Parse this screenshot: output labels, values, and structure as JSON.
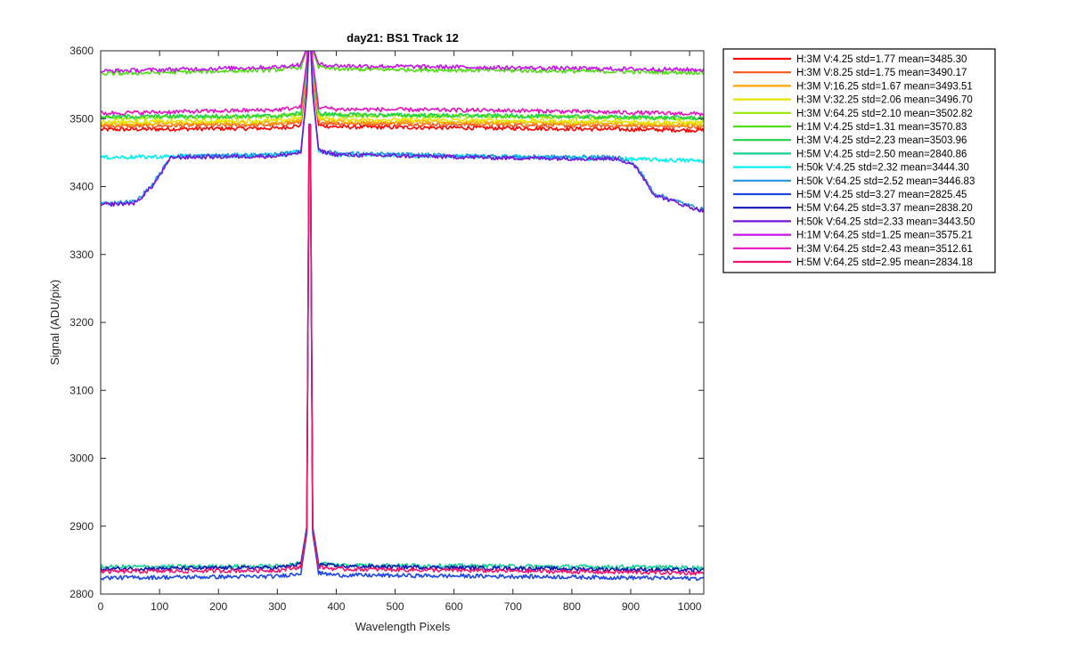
{
  "chart_data": {
    "type": "line",
    "title": "day21: BS1  Track 12",
    "xlabel": "Wavelength Pixels",
    "ylabel": "Signal (ADU/pix)",
    "xlim": [
      0,
      1024
    ],
    "ylim": [
      2800,
      3600
    ],
    "x_ticks": [
      0,
      100,
      200,
      300,
      400,
      500,
      600,
      700,
      800,
      900,
      1000
    ],
    "y_ticks": [
      2800,
      2900,
      3000,
      3100,
      3200,
      3300,
      3400,
      3500,
      3600
    ],
    "grid": false,
    "legend_position": "outside-right",
    "peak_pixel": 355,
    "series": [
      {
        "name": "H:3M V:4.25   std=1.77 mean=3485.30",
        "color": "#ff0000",
        "points": [
          [
            0,
            3484
          ],
          [
            300,
            3486
          ],
          [
            340,
            3490
          ],
          [
            350,
            3560
          ],
          [
            355,
            3640
          ],
          [
            360,
            3560
          ],
          [
            370,
            3490
          ],
          [
            400,
            3488
          ],
          [
            700,
            3486
          ],
          [
            1024,
            3483
          ]
        ]
      },
      {
        "name": "H:3M V:8.25   std=1.75 mean=3490.17",
        "color": "#ff5a1e",
        "points": [
          [
            0,
            3489
          ],
          [
            300,
            3491
          ],
          [
            340,
            3495
          ],
          [
            350,
            3565
          ],
          [
            355,
            3640
          ],
          [
            360,
            3565
          ],
          [
            370,
            3495
          ],
          [
            400,
            3493
          ],
          [
            700,
            3491
          ],
          [
            1024,
            3488
          ]
        ]
      },
      {
        "name": "H:3M V:16.25  std=1.67 mean=3493.51",
        "color": "#ffa500",
        "points": [
          [
            0,
            3492
          ],
          [
            300,
            3494
          ],
          [
            340,
            3498
          ],
          [
            350,
            3568
          ],
          [
            355,
            3640
          ],
          [
            360,
            3568
          ],
          [
            370,
            3498
          ],
          [
            400,
            3496
          ],
          [
            700,
            3494
          ],
          [
            1024,
            3491
          ]
        ]
      },
      {
        "name": "H:3M V:32.25  std=2.06 mean=3496.70",
        "color": "#e5e500",
        "points": [
          [
            0,
            3495
          ],
          [
            300,
            3497
          ],
          [
            340,
            3501
          ],
          [
            350,
            3570
          ],
          [
            355,
            3640
          ],
          [
            360,
            3570
          ],
          [
            370,
            3501
          ],
          [
            400,
            3499
          ],
          [
            700,
            3497
          ],
          [
            1024,
            3494
          ]
        ]
      },
      {
        "name": "H:3M V:64.25  std=2.10 mean=3502.82",
        "color": "#96e600",
        "points": [
          [
            0,
            3501
          ],
          [
            300,
            3503
          ],
          [
            340,
            3507
          ],
          [
            350,
            3575
          ],
          [
            355,
            3640
          ],
          [
            360,
            3575
          ],
          [
            370,
            3507
          ],
          [
            400,
            3505
          ],
          [
            700,
            3503
          ],
          [
            1024,
            3500
          ]
        ]
      },
      {
        "name": "H:1M V:4.25   std=1.31 mean=3570.83",
        "color": "#50dc14",
        "points": [
          [
            0,
            3566
          ],
          [
            300,
            3572
          ],
          [
            340,
            3576
          ],
          [
            350,
            3600
          ],
          [
            355,
            3640
          ],
          [
            360,
            3600
          ],
          [
            370,
            3576
          ],
          [
            400,
            3573
          ],
          [
            700,
            3571
          ],
          [
            1024,
            3568
          ]
        ]
      },
      {
        "name": "H:3M V:4.25   std=2.23 mean=3503.96",
        "color": "#1ed24b",
        "points": [
          [
            0,
            3503
          ],
          [
            300,
            3504
          ],
          [
            340,
            3508
          ],
          [
            350,
            3576
          ],
          [
            355,
            3640
          ],
          [
            360,
            3576
          ],
          [
            370,
            3508
          ],
          [
            400,
            3506
          ],
          [
            700,
            3504
          ],
          [
            1024,
            3501
          ]
        ]
      },
      {
        "name": "H:5M V:4.25   std=2.50 mean=2840.86",
        "color": "#14d296",
        "points": [
          [
            0,
            2840
          ],
          [
            300,
            2841
          ],
          [
            340,
            2846
          ],
          [
            350,
            2900
          ],
          [
            355,
            3640
          ],
          [
            360,
            2900
          ],
          [
            370,
            2846
          ],
          [
            400,
            2843
          ],
          [
            700,
            2841
          ],
          [
            1024,
            2839
          ]
        ]
      },
      {
        "name": "H:50k V:4.25  std=2.32 mean=3444.30",
        "color": "#00f0f0",
        "points": [
          [
            0,
            3443
          ],
          [
            300,
            3446
          ],
          [
            340,
            3452
          ],
          [
            350,
            3540
          ],
          [
            355,
            3640
          ],
          [
            360,
            3540
          ],
          [
            370,
            3452
          ],
          [
            400,
            3447
          ],
          [
            700,
            3444
          ],
          [
            1024,
            3438
          ]
        ]
      },
      {
        "name": "H:50k V:64.25 std=2.52 mean=3446.83",
        "color": "#1e96e6",
        "points": [
          [
            0,
            3375
          ],
          [
            60,
            3378
          ],
          [
            90,
            3405
          ],
          [
            120,
            3445
          ],
          [
            300,
            3447
          ],
          [
            340,
            3452
          ],
          [
            350,
            3540
          ],
          [
            355,
            3640
          ],
          [
            360,
            3540
          ],
          [
            370,
            3455
          ],
          [
            400,
            3449
          ],
          [
            700,
            3444
          ],
          [
            880,
            3443
          ],
          [
            910,
            3430
          ],
          [
            940,
            3390
          ],
          [
            1000,
            3372
          ],
          [
            1024,
            3366
          ]
        ]
      },
      {
        "name": "H:5M V:4.25   std=3.27 mean=2825.45",
        "color": "#1e46e6",
        "points": [
          [
            0,
            2824
          ],
          [
            300,
            2826
          ],
          [
            340,
            2831
          ],
          [
            350,
            2890
          ],
          [
            355,
            3640
          ],
          [
            360,
            2890
          ],
          [
            370,
            2831
          ],
          [
            400,
            2828
          ],
          [
            700,
            2826
          ],
          [
            1024,
            2823
          ]
        ]
      },
      {
        "name": "H:5M V:64.25  std=3.37 mean=2838.20",
        "color": "#1414b4",
        "points": [
          [
            0,
            2837
          ],
          [
            300,
            2839
          ],
          [
            340,
            2844
          ],
          [
            350,
            2898
          ],
          [
            355,
            3640
          ],
          [
            360,
            2898
          ],
          [
            370,
            2844
          ],
          [
            400,
            2841
          ],
          [
            700,
            2838
          ],
          [
            1024,
            2835
          ]
        ]
      },
      {
        "name": "H:50k V:64.25 std=2.33 mean=3443.50",
        "color": "#7814dc",
        "points": [
          [
            0,
            3373
          ],
          [
            60,
            3376
          ],
          [
            90,
            3403
          ],
          [
            120,
            3443
          ],
          [
            300,
            3445
          ],
          [
            340,
            3450
          ],
          [
            350,
            3538
          ],
          [
            355,
            3640
          ],
          [
            360,
            3538
          ],
          [
            370,
            3453
          ],
          [
            400,
            3447
          ],
          [
            700,
            3442
          ],
          [
            880,
            3441
          ],
          [
            910,
            3428
          ],
          [
            940,
            3388
          ],
          [
            1000,
            3370
          ],
          [
            1024,
            3364
          ]
        ]
      },
      {
        "name": "H:1M V:64.25  std=1.25 mean=3575.21",
        "color": "#c814f0",
        "points": [
          [
            0,
            3570
          ],
          [
            300,
            3576
          ],
          [
            340,
            3580
          ],
          [
            350,
            3605
          ],
          [
            355,
            3640
          ],
          [
            360,
            3605
          ],
          [
            370,
            3580
          ],
          [
            400,
            3578
          ],
          [
            700,
            3575
          ],
          [
            1024,
            3572
          ]
        ]
      },
      {
        "name": "H:3M V:64.25  std=2.43 mean=3512.61",
        "color": "#e614be",
        "points": [
          [
            0,
            3508
          ],
          [
            300,
            3513
          ],
          [
            340,
            3517
          ],
          [
            350,
            3585
          ],
          [
            355,
            3640
          ],
          [
            360,
            3585
          ],
          [
            370,
            3517
          ],
          [
            400,
            3514
          ],
          [
            700,
            3512
          ],
          [
            1024,
            3507
          ]
        ]
      },
      {
        "name": "H:5M V:64.25  std=2.95 mean=2834.18",
        "color": "#f0146e",
        "points": [
          [
            0,
            2833
          ],
          [
            300,
            2835
          ],
          [
            340,
            2840
          ],
          [
            350,
            2895
          ],
          [
            355,
            3640
          ],
          [
            360,
            2895
          ],
          [
            370,
            2840
          ],
          [
            400,
            2837
          ],
          [
            700,
            2834
          ],
          [
            1024,
            2831
          ]
        ]
      }
    ]
  }
}
